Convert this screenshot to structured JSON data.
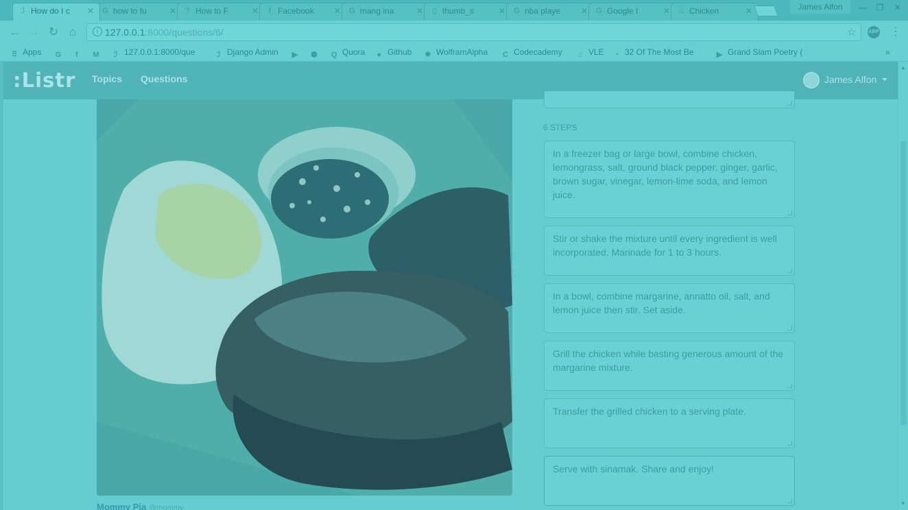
{
  "browser": {
    "tabs": [
      {
        "label": "How do I c",
        "icon": "listr-icon",
        "active": true
      },
      {
        "label": "how to fu",
        "icon": "google-icon"
      },
      {
        "label": "How to F",
        "icon": "question-icon"
      },
      {
        "label": "Facebook",
        "icon": "facebook-icon"
      },
      {
        "label": "mang ina",
        "icon": "google-icon"
      },
      {
        "label": "thumb_s",
        "icon": "page-icon"
      },
      {
        "label": "nba playe",
        "icon": "google-icon"
      },
      {
        "label": "Google I",
        "icon": "google-icon"
      },
      {
        "label": "Chicken",
        "icon": "chicken-icon"
      }
    ],
    "window_user": "James Alfon",
    "url_host": "127.0.0.1",
    "url_path": ":8000/questions/6/",
    "bookmarks": [
      {
        "label": "Apps",
        "icon": "apps-grid-icon"
      },
      {
        "label": "",
        "icon": "google-icon"
      },
      {
        "label": "",
        "icon": "facebook-icon"
      },
      {
        "label": "",
        "icon": "gmail-icon"
      },
      {
        "label": "127.0.0.1:8000/que",
        "icon": "listr-icon"
      },
      {
        "label": "Django Admin",
        "icon": "listr-icon"
      },
      {
        "label": "",
        "icon": "youtube-icon"
      },
      {
        "label": "",
        "icon": "hex-icon"
      },
      {
        "label": "Quora",
        "icon": "quora-icon"
      },
      {
        "label": "Github",
        "icon": "github-icon"
      },
      {
        "label": "WolframAlpha",
        "icon": "wolfram-icon"
      },
      {
        "label": "Codecademy",
        "icon": "codecademy-icon"
      },
      {
        "label": "VLE",
        "icon": "vle-icon"
      },
      {
        "label": "32 Of The Most Be",
        "icon": "circle-icon"
      },
      {
        "label": "Grand Slam Poetry (",
        "icon": "youtube-icon"
      }
    ]
  },
  "site": {
    "brand": ":Listr",
    "nav": {
      "topics": "Topics",
      "questions": "Questions"
    },
    "user": "James Alfon"
  },
  "recipe": {
    "author_name": "Mommy Pia",
    "author_handle": "@mommy",
    "steps_heading": "6 STEPS",
    "steps": [
      "In a freezer bag or large bowl, combine chicken, lemongrass, salt, ground black pepper, ginger, garlic, brown sugar, vinegar, lemon-lime soda, and lemon juice.",
      "Stir or shake the mixture until every ingredient is well incorporated. Marinade for 1 to 3 hours.",
      "In a bowl, combine margarine, annatto oil, salt, and lemon juice then stir. Set aside.",
      "Grill the chicken while basting generous amount of the margarine mixture.",
      "Transfer the grilled chicken to a serving plate.",
      "Serve with sinamak. Share and enjoy!"
    ]
  },
  "colors": {
    "overlay": "#5fc8cc",
    "navbar": "#4fb3b8",
    "text": "#3c9da2"
  }
}
